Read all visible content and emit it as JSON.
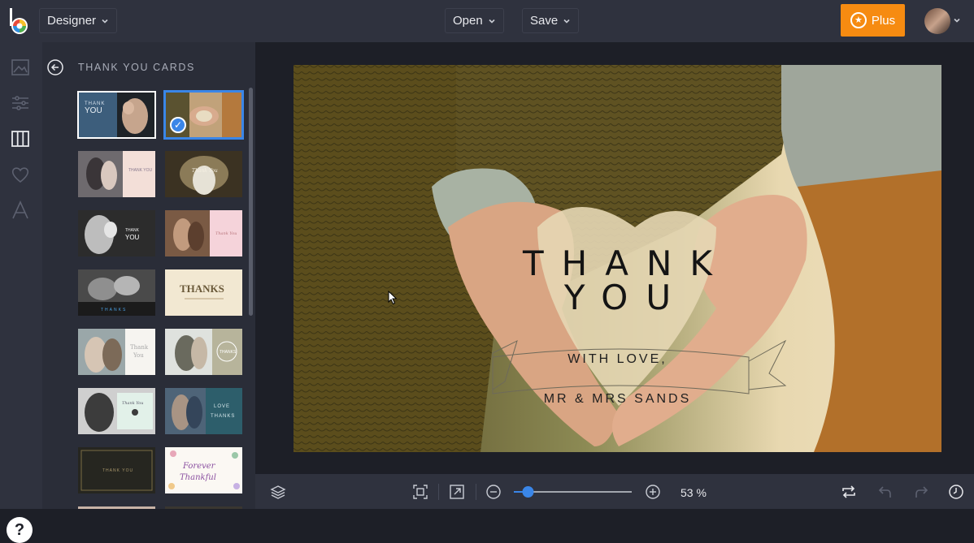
{
  "topbar": {
    "mode_label": "Designer",
    "open_label": "Open",
    "save_label": "Save",
    "plus_label": "Plus"
  },
  "panel": {
    "title": "THANK YOU CARDS"
  },
  "card": {
    "title_line1": "THANK",
    "title_line2": "YOU",
    "subtitle": "WITH LOVE,",
    "names": "MR & MRS SANDS"
  },
  "bottombar": {
    "zoom_value": "53 %",
    "zoom_level": 0.1
  },
  "thumbnails": [
    {
      "text": "THANK YOU",
      "selected": false
    },
    {
      "text": "",
      "selected": true
    },
    {
      "text": "THANK YOU",
      "selected": false
    },
    {
      "text": "",
      "selected": false
    },
    {
      "text": "THANK YOU",
      "selected": false
    },
    {
      "text": "Thank You",
      "selected": false
    },
    {
      "text": "THANKS",
      "selected": false
    },
    {
      "text": "THANKS",
      "selected": false
    },
    {
      "text": "Thank You",
      "selected": false
    },
    {
      "text": "THANKS",
      "selected": false
    },
    {
      "text": "Thank You",
      "selected": false
    },
    {
      "text": "LOVE THANKS",
      "selected": false
    },
    {
      "text": "THANK YOU",
      "selected": false
    },
    {
      "text": "Forever Thankful",
      "selected": false
    }
  ],
  "colors": {
    "accent": "#3a86e8",
    "plus": "#f68b11"
  }
}
